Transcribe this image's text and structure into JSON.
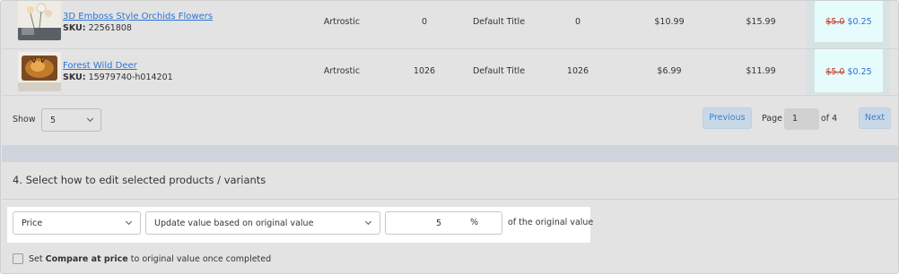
{
  "products": [
    {
      "name": "3D Emboss Style Orchids Flowers",
      "sku_label": "SKU:",
      "sku": "22561808",
      "vendor": "Artrostic",
      "inventory": "0",
      "variant": "Default Title",
      "quantity": "0",
      "cost": "$10.99",
      "price": "$15.99",
      "old_value": "$5.0",
      "new_value": "$0.25"
    },
    {
      "name": "Forest Wild Deer",
      "sku_label": "SKU:",
      "sku": "15979740-h014201",
      "vendor": "Artrostic",
      "inventory": "1026",
      "variant": "Default Title",
      "quantity": "1026",
      "cost": "$6.99",
      "price": "$11.99",
      "old_value": "$5.0",
      "new_value": "$0.25"
    }
  ],
  "pagination": {
    "show_label": "Show",
    "page_size": "5",
    "previous_label": "Previous",
    "page_label": "Page",
    "current_page": "1",
    "of_label": "of 4",
    "next_label": "Next"
  },
  "section": {
    "title": "4. Select how to edit selected products / variants",
    "field_select": "Price",
    "method_select": "Update value based on original value",
    "amount": "5",
    "unit": "%",
    "suffix": "of the original value",
    "checkbox_pre": "Set ",
    "checkbox_bold": "Compare at price",
    "checkbox_post": " to original value once completed"
  },
  "colors": {
    "link": "#2a73d8",
    "strike": "#c0392b",
    "highlight": "#e6fbfb"
  }
}
